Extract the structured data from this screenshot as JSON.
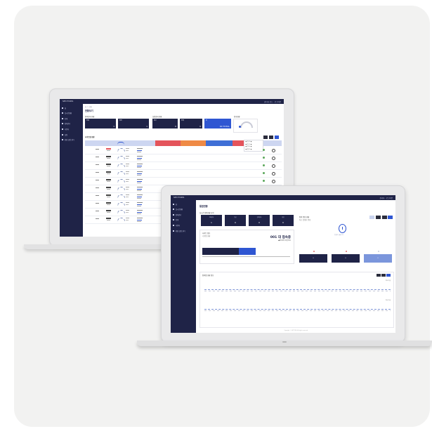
{
  "back": {
    "brand": "SECTORS",
    "topright": "관리자 모드 · 로그아웃",
    "nav": [
      "홈",
      "실시간현황",
      "통계",
      "장비관리",
      "사용자",
      "설정",
      "환경 설정 관리"
    ],
    "breadcrumb": "홈 > 현황",
    "page_title": "현황보기",
    "section_a": "장비상태 현황",
    "section_b": "설정상태 현황",
    "section_c": "접속현황",
    "section_table": "사이트별 현황",
    "cards": [
      {
        "label": "전체",
        "value": "1"
      },
      {
        "label": "정상",
        "value": "1"
      },
      {
        "label": "경고",
        "value": "0"
      },
      {
        "label": "장애",
        "value": "0"
      },
      {
        "label": "총",
        "value": "00 TOTAL"
      }
    ],
    "legend": [
      "● 정상 3 ●",
      "● 경고 3 ●",
      "● 장애 3 ●",
      "● 점검 3 ●"
    ],
    "rows": 10
  },
  "front": {
    "brand": "SECTORS",
    "topright": "관리자 · 로그아웃",
    "nav": [
      "홈",
      "실시간현황",
      "장비관리",
      "통계",
      "사용자",
      "환경 설정 관리"
    ],
    "page_title": "통합현황",
    "section_status": "실시간 장비현황 요약",
    "status_cards": [
      {
        "label": "전체장비",
        "value": "1"
      },
      {
        "label": "정상",
        "value": "0"
      },
      {
        "label": "장애장비",
        "value": "0"
      },
      {
        "label": "점검",
        "value": "0"
      }
    ],
    "section_info": "사이트 정보",
    "info_line": "기관별 현황",
    "kpi": "001 대 접속중",
    "kpi_sub": "●접속장비 총합 정보",
    "section_right": "장비 알림 현황",
    "right_sub": "최근 발생한 알림",
    "empty_text": "알림이 없습니다",
    "bottom_boxes": [
      "0",
      "0",
      "0"
    ],
    "section_chart": "장비별 현황 정보",
    "chart_label_1": "최근 7일",
    "chart_label_2": "최근 7일",
    "footer": "Copyright © SECTORS. All rights reserved."
  }
}
